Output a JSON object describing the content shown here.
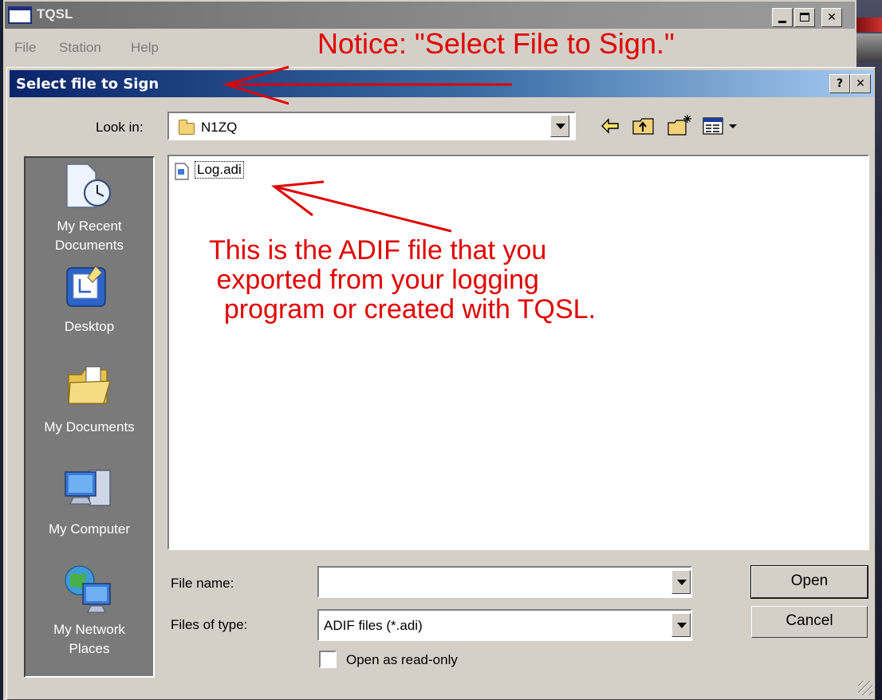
{
  "app": {
    "title": "TQSL",
    "menu": [
      "File",
      "Station",
      "Help"
    ]
  },
  "notice": "Notice: \"Select File to Sign.\"",
  "dialog": {
    "title": "Select file to Sign",
    "look_in_label": "Look in:",
    "look_in_value": "N1ZQ",
    "places": [
      "My Recent\nDocuments",
      "Desktop",
      "My Documents",
      "My Computer",
      "My Network\nPlaces"
    ],
    "files": [
      "Log.adi"
    ],
    "file_name_label": "File name:",
    "file_name_value": "",
    "files_of_type_label": "Files of type:",
    "files_of_type_value": "ADIF files (*.adi)",
    "read_only_label": "Open as read-only",
    "open_label": "Open",
    "cancel_label": "Cancel"
  },
  "annotation": "This is the ADIF file that you\n exported from your logging\n  program or created with TQSL.",
  "colors": {
    "annotation": "#e00000",
    "dialog_title_start": "#0a246a",
    "dialog_title_end": "#a6caf0",
    "places_bar": "#7a7a7a"
  },
  "icons": [
    "back-arrow-icon",
    "up-folder-icon",
    "new-folder-icon",
    "view-menu-icon",
    "help-icon",
    "close-icon",
    "minimize-icon",
    "maximize-icon"
  ]
}
